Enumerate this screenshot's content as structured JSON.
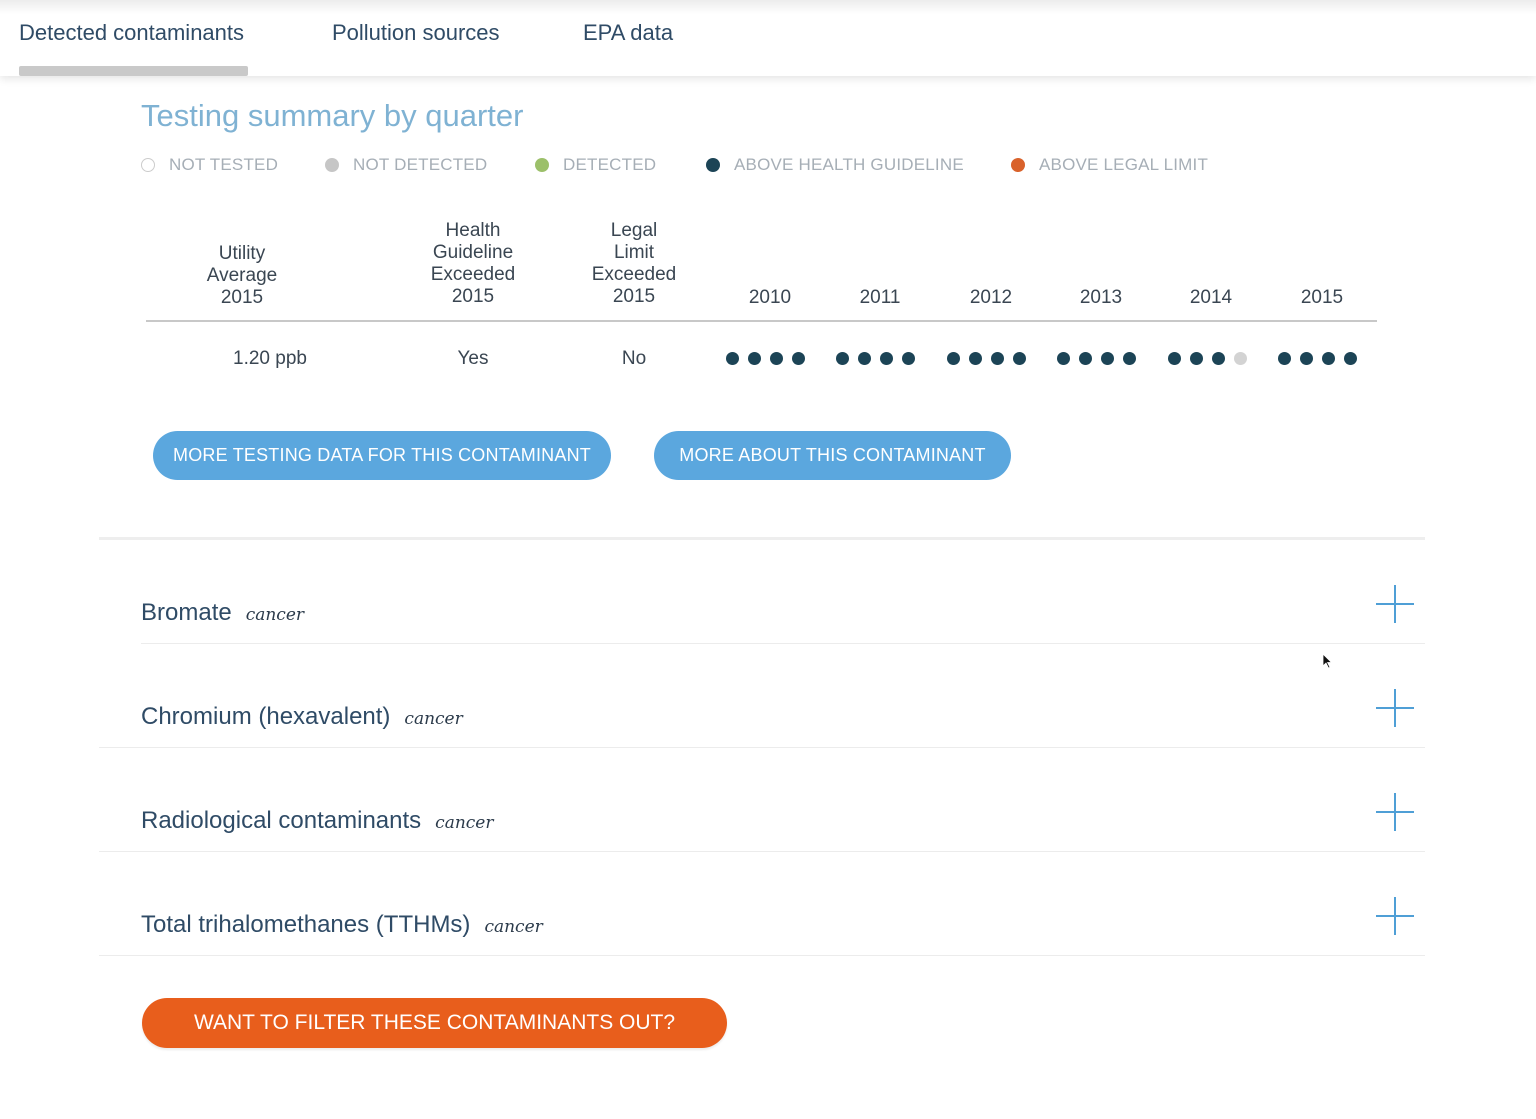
{
  "tabs": [
    {
      "label": "Detected contaminants",
      "active": true
    },
    {
      "label": "Pollution sources",
      "active": false
    },
    {
      "label": "EPA data",
      "active": false
    }
  ],
  "section_title": "Testing summary by quarter",
  "legend": [
    {
      "label": "NOT TESTED",
      "color": "#ffffff",
      "border": "#cccccc"
    },
    {
      "label": "NOT DETECTED",
      "color": "#c6c6c6"
    },
    {
      "label": "DETECTED",
      "color": "#9cc06a"
    },
    {
      "label": "ABOVE HEALTH GUIDELINE",
      "color": "#1c4456"
    },
    {
      "label": "ABOVE LEGAL LIMIT",
      "color": "#d9622b"
    }
  ],
  "table": {
    "headers": {
      "utility_average": [
        "Utility",
        "Average",
        "2015"
      ],
      "health_guideline": [
        "Health",
        "Guideline",
        "Exceeded",
        "2015"
      ],
      "legal_limit": [
        "Legal",
        "Limit",
        "Exceeded",
        "2015"
      ],
      "years": [
        "2010",
        "2011",
        "2012",
        "2013",
        "2014",
        "2015"
      ]
    },
    "row": {
      "utility_average": "1.20 ppb",
      "health_guideline_exceeded": "Yes",
      "legal_limit_exceeded": "No",
      "quarters": [
        [
          "above_health",
          "above_health",
          "above_health",
          "above_health"
        ],
        [
          "above_health",
          "above_health",
          "above_health",
          "above_health"
        ],
        [
          "above_health",
          "above_health",
          "above_health",
          "above_health"
        ],
        [
          "above_health",
          "above_health",
          "above_health",
          "above_health"
        ],
        [
          "above_health",
          "above_health",
          "above_health",
          "not_detected"
        ],
        [
          "above_health",
          "above_health",
          "above_health",
          "above_health"
        ]
      ]
    }
  },
  "status_colors": {
    "above_health": "#1c4456",
    "not_detected": "#d3d3d3"
  },
  "buttons": {
    "more_testing": "MORE TESTING DATA FOR THIS CONTAMINANT",
    "more_about": "MORE ABOUT THIS CONTAMINANT",
    "filter": "WANT TO FILTER THESE CONTAMINANTS OUT?"
  },
  "contaminants": [
    {
      "name": "Bromate",
      "tag": "cancer"
    },
    {
      "name": "Chromium (hexavalent)",
      "tag": "cancer"
    },
    {
      "name": "Radiological contaminants",
      "tag": "cancer"
    },
    {
      "name": "Total trihalomethanes (TTHMs)",
      "tag": "cancer"
    }
  ],
  "icons": {
    "expand": "plus-icon",
    "legend_marker": "circle"
  }
}
